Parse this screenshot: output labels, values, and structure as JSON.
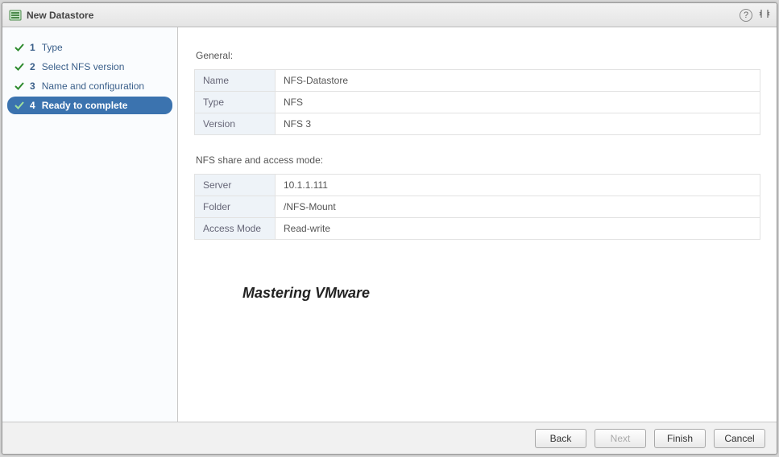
{
  "window": {
    "title": "New Datastore"
  },
  "steps": [
    {
      "num": "1",
      "label": "Type",
      "done": true,
      "active": false
    },
    {
      "num": "2",
      "label": "Select NFS version",
      "done": true,
      "active": false
    },
    {
      "num": "3",
      "label": "Name and configuration",
      "done": true,
      "active": false
    },
    {
      "num": "4",
      "label": "Ready to complete",
      "done": true,
      "active": true
    }
  ],
  "sections": {
    "general": {
      "title": "General:",
      "rows": [
        {
          "key": "Name",
          "value": "NFS-Datastore"
        },
        {
          "key": "Type",
          "value": "NFS"
        },
        {
          "key": "Version",
          "value": "NFS 3"
        }
      ]
    },
    "share": {
      "title": "NFS share and access mode:",
      "rows": [
        {
          "key": "Server",
          "value": "10.1.1.111"
        },
        {
          "key": "Folder",
          "value": "/NFS-Mount"
        },
        {
          "key": "Access Mode",
          "value": "Read-write"
        }
      ]
    }
  },
  "watermark": "Mastering VMware",
  "buttons": {
    "back": "Back",
    "next": "Next",
    "finish": "Finish",
    "cancel": "Cancel"
  }
}
